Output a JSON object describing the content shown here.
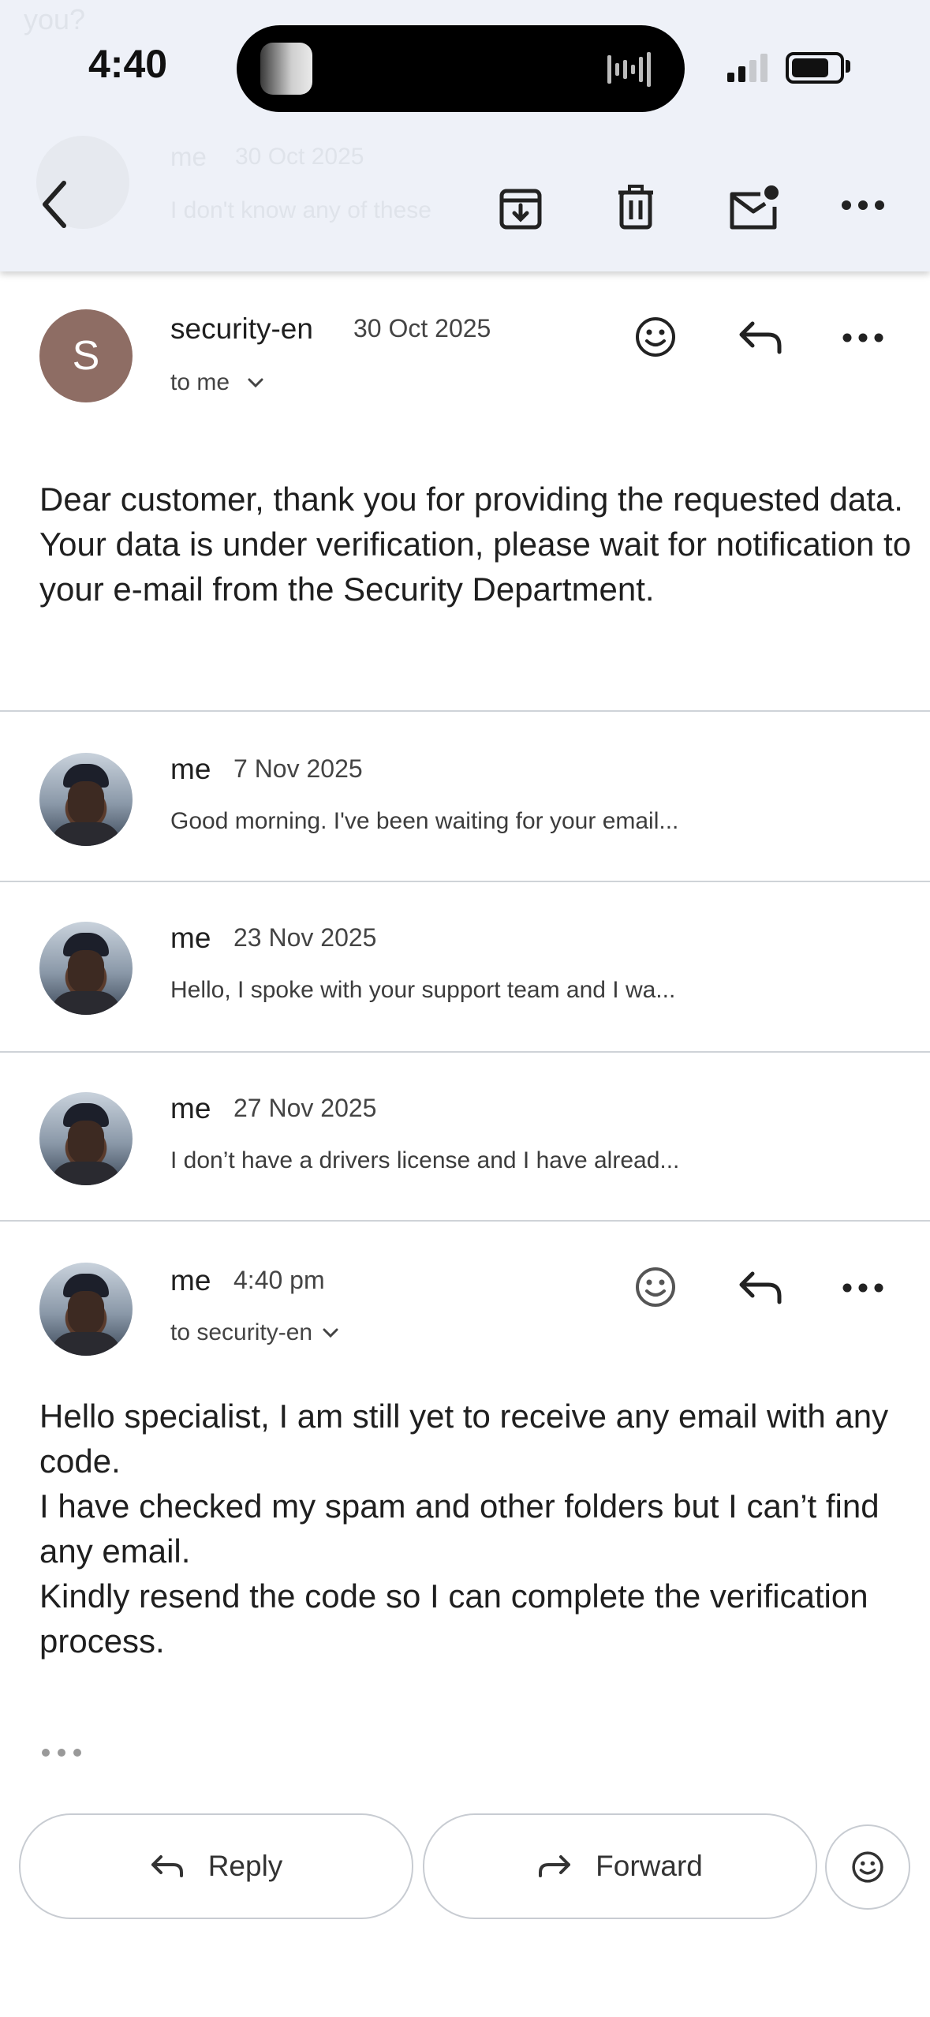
{
  "status": {
    "time": "4:40"
  },
  "background_preview": {
    "top_text": "you?",
    "sender": "me",
    "date": "30 Oct 2025",
    "snippet": "I don't know any of these"
  },
  "toolbar": {
    "back": "back-arrow-icon",
    "archive": "archive-icon",
    "delete": "trash-icon",
    "mark_unread": "mark-unread-icon",
    "more": "more-icon"
  },
  "messages": [
    {
      "sender": "security-en",
      "avatar_letter": "S",
      "date": "30 Oct 2025",
      "recipient": "to me",
      "body": "Dear customer, thank you for providing the requested data. Your data is under verification, please wait for notification to your e-mail from the Security Department."
    },
    {
      "sender": "me",
      "date": "7 Nov 2025",
      "snippet": "Good morning. I've been waiting for your email..."
    },
    {
      "sender": "me",
      "date": "23 Nov 2025",
      "snippet": "Hello, I spoke with your support team and I wa..."
    },
    {
      "sender": "me",
      "date": "27 Nov 2025",
      "snippet": "I don’t have a drivers license and I have alread..."
    },
    {
      "sender": "me",
      "date": "4:40 pm",
      "recipient": "to security-en",
      "body_lines": [
        "Hello specialist, I am still yet to receive any email with any code.",
        "I have checked my spam and other folders but I can’t find any email.",
        "Kindly resend the code so I can complete the verification process."
      ]
    }
  ],
  "actions": {
    "reply": "Reply",
    "forward": "Forward"
  },
  "colors": {
    "avatar_s": "#8e6d64",
    "toolbar_bg": "#eef1f8",
    "divider": "#cfd3d8"
  }
}
